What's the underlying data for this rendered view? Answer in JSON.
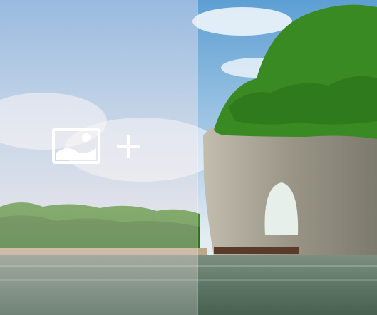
{
  "toolbar": {
    "image_icon": "image-placeholder-icon",
    "add_icon": "plus-icon"
  },
  "colors": {
    "overlay_tint": "#f4e4ec",
    "icon_color": "#ffffff",
    "sky_top": "#5d9fd3",
    "foliage": "#3f8a2a",
    "rock": "#9a9586",
    "water": "#5e7667"
  }
}
